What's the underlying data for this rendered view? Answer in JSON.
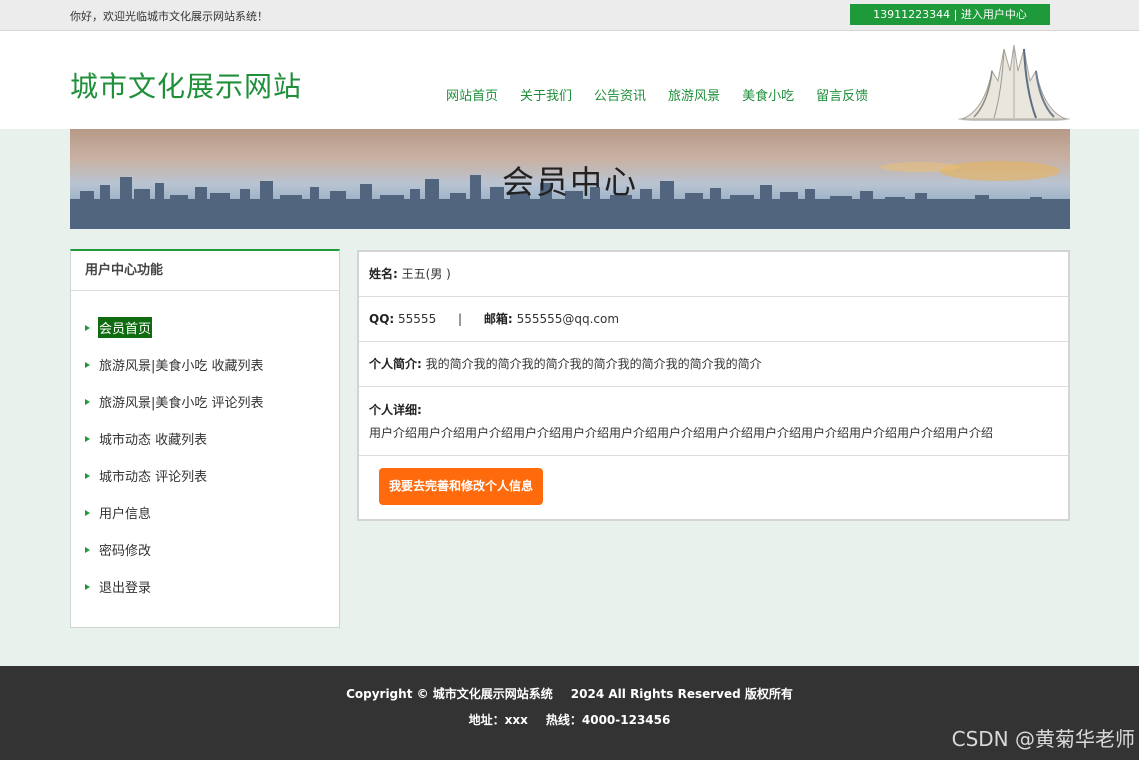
{
  "topbar": {
    "welcome": "你好，欢迎光临城市文化展示网站系统！",
    "user_center_button": "13911223344 | 进入用户中心"
  },
  "header": {
    "logo": "城市文化展示网站",
    "nav": [
      "网站首页",
      "关于我们",
      "公告资讯",
      "旅游风景",
      "美食小吃",
      "留言反馈"
    ]
  },
  "banner": {
    "title": "会员中心"
  },
  "sidebar": {
    "title": "用户中心功能",
    "items": [
      {
        "label": "会员首页",
        "active": true
      },
      {
        "label": "旅游风景|美食小吃 收藏列表"
      },
      {
        "label": "旅游风景|美食小吃 评论列表"
      },
      {
        "label": "城市动态 收藏列表"
      },
      {
        "label": "城市动态 评论列表"
      },
      {
        "label": "用户信息"
      },
      {
        "label": "密码修改"
      },
      {
        "label": "退出登录"
      }
    ]
  },
  "profile": {
    "name_label": "姓名:",
    "name_value": "王五(男 )",
    "qq_label": "QQ:",
    "qq_value": "55555",
    "separator": "|",
    "email_label": "邮箱:",
    "email_value": "555555@qq.com",
    "intro_label": "个人简介:",
    "intro_value": "我的简介我的简介我的简介我的简介我的简介我的简介我的简介",
    "detail_label": "个人详细:",
    "detail_value": "用户介绍用户介绍用户介绍用户介绍用户介绍用户介绍用户介绍用户介绍用户介绍用户介绍用户介绍用户介绍用户介绍",
    "edit_button": "我要去完善和修改个人信息"
  },
  "footer": {
    "copyright": "Copyright © 城市文化展示网站系统",
    "rights": "2024 All Rights Reserved 版权所有",
    "address": "地址：xxx",
    "hotline": "热线：4000-123456"
  },
  "watermark": "CSDN @黄菊华老师",
  "colors": {
    "accent_green": "#1f9a3a",
    "active_item": "#106b10",
    "edit_button": "#ff6a0d",
    "footer_bg": "#333333",
    "page_bg": "#e8f1ec"
  }
}
